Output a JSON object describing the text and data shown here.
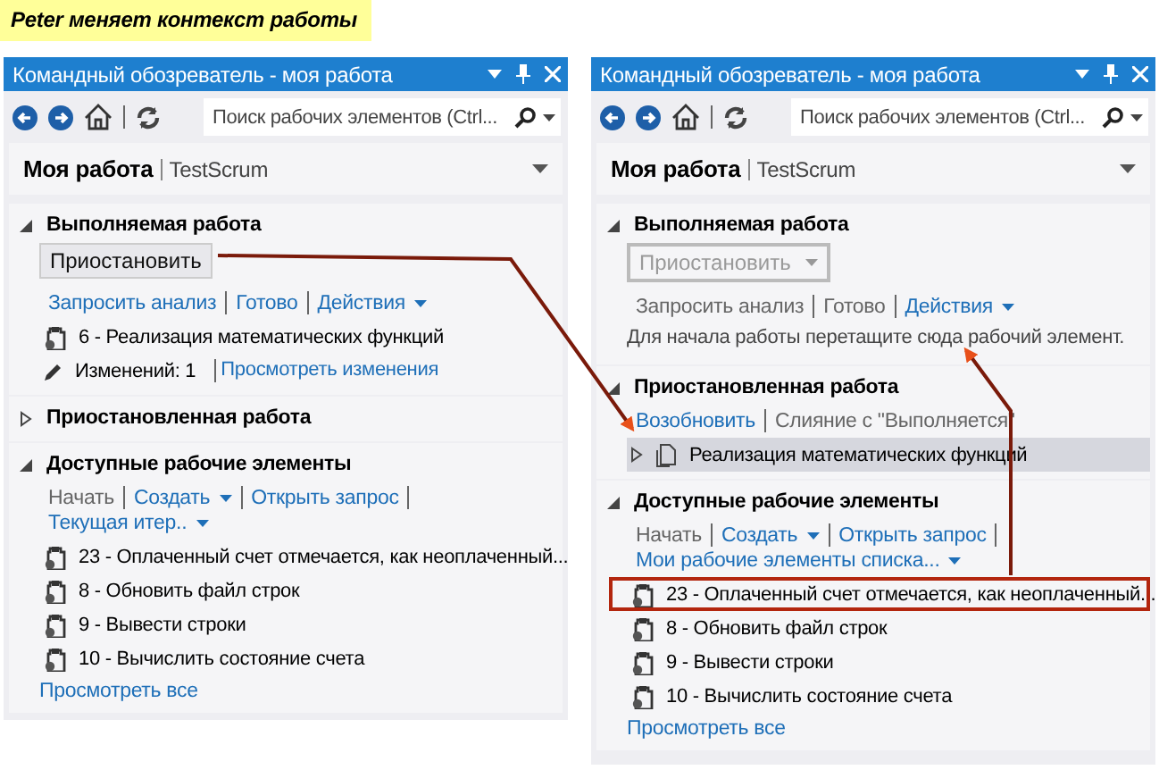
{
  "caption": "Peter меняет контекст работы",
  "panels": [
    {
      "title": "Командный обозреватель - моя работа",
      "search": {
        "placeholder": "Поиск рабочих элементов (Ctrl..."
      },
      "header": {
        "title": "Моя работа",
        "project": "TestScrum"
      },
      "sections": [
        {
          "title": "Выполняемая работа",
          "expanded": true,
          "button": {
            "label": "Приостановить",
            "disabled": false,
            "dropdown": false
          },
          "actions": [
            {
              "label": "Запросить анализ",
              "disabled": false,
              "dropdown": false
            },
            {
              "label": "Готово",
              "disabled": false,
              "dropdown": false
            },
            {
              "label": "Действия",
              "disabled": false,
              "dropdown": true
            }
          ],
          "items": [
            {
              "kind": "workitem",
              "text": "6 - Реализация математических функций",
              "selected": false,
              "highlighted": false
            },
            {
              "kind": "changes",
              "text": "Изменений: 1",
              "link": "Просмотреть изменения"
            }
          ]
        },
        {
          "title": "Приостановленная работа",
          "expanded": false
        },
        {
          "title": "Доступные рабочие элементы",
          "expanded": true,
          "actions": [
            {
              "label": "Начать",
              "disabled": true,
              "dropdown": false
            },
            {
              "label": "Создать",
              "disabled": false,
              "dropdown": true
            },
            {
              "label": "Открыть запрос",
              "disabled": false,
              "dropdown": false
            },
            {
              "label": "Текущая итер..",
              "disabled": false,
              "dropdown": true
            }
          ],
          "items": [
            {
              "kind": "workitem",
              "text": "23 - Оплаченный счет отмечается, как неоплаченный...",
              "selected": false,
              "highlighted": false
            },
            {
              "kind": "workitem",
              "text": "8 - Обновить файл строк",
              "selected": false,
              "highlighted": false
            },
            {
              "kind": "workitem",
              "text": "9 - Вывести строки",
              "selected": false,
              "highlighted": false
            },
            {
              "kind": "workitem",
              "text": "10 - Вычислить состояние счета",
              "selected": false,
              "highlighted": false
            }
          ],
          "footer_link": "Просмотреть все"
        }
      ]
    },
    {
      "title": "Командный обозреватель - моя работа",
      "search": {
        "placeholder": "Поиск рабочих элементов (Ctrl..."
      },
      "header": {
        "title": "Моя работа",
        "project": "TestScrum"
      },
      "sections": [
        {
          "title": "Выполняемая работа",
          "expanded": true,
          "button": {
            "label": "Приостановить",
            "disabled": true,
            "dropdown": true
          },
          "actions": [
            {
              "label": "Запросить анализ",
              "disabled": true,
              "dropdown": false
            },
            {
              "label": "Готово",
              "disabled": true,
              "dropdown": false
            },
            {
              "label": "Действия",
              "disabled": false,
              "dropdown": true
            }
          ],
          "hint": "Для начала работы перетащите сюда рабочий элемент."
        },
        {
          "title": "Приостановленная работа",
          "expanded": true,
          "actions": [
            {
              "label": "Возобновить",
              "disabled": false,
              "dropdown": false
            },
            {
              "label": "Слияние с \"Выполняется\"",
              "disabled": true,
              "dropdown": false
            }
          ],
          "items": [
            {
              "kind": "suspended",
              "text": "Реализация математических функций",
              "selected": true
            }
          ]
        },
        {
          "title": "Доступные рабочие элементы",
          "expanded": true,
          "actions": [
            {
              "label": "Начать",
              "disabled": true,
              "dropdown": false
            },
            {
              "label": "Создать",
              "disabled": false,
              "dropdown": true
            },
            {
              "label": "Открыть запрос",
              "disabled": false,
              "dropdown": false
            },
            {
              "label": "Мои рабочие элементы списка...",
              "disabled": false,
              "dropdown": true
            }
          ],
          "items": [
            {
              "kind": "workitem",
              "text": "23 - Оплаченный счет отмечается, как неоплаченный...",
              "selected": false,
              "highlighted": true
            },
            {
              "kind": "workitem",
              "text": "8 - Обновить файл строк",
              "selected": false,
              "highlighted": false
            },
            {
              "kind": "workitem",
              "text": "9 - Вывести строки",
              "selected": false,
              "highlighted": false
            },
            {
              "kind": "workitem",
              "text": "10 - Вычислить состояние счета",
              "selected": false,
              "highlighted": false
            }
          ],
          "footer_link": "Просмотреть все"
        }
      ]
    }
  ]
}
